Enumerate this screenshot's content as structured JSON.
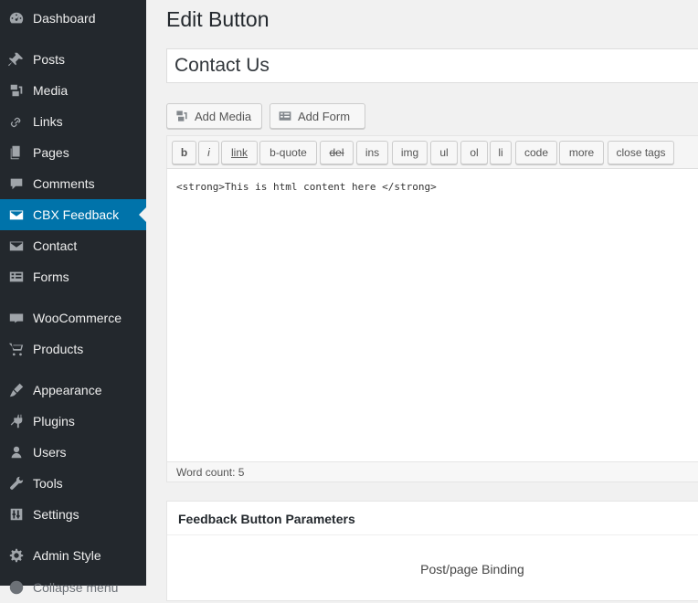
{
  "sidebar": {
    "items": [
      {
        "label": "Dashboard",
        "icon": "dashboard-icon"
      },
      {
        "label": "Posts",
        "icon": "pin-icon"
      },
      {
        "label": "Media",
        "icon": "media-icon"
      },
      {
        "label": "Links",
        "icon": "link-icon"
      },
      {
        "label": "Pages",
        "icon": "pages-icon"
      },
      {
        "label": "Comments",
        "icon": "comment-icon"
      },
      {
        "label": "CBX Feedback",
        "icon": "envelope-icon",
        "active": true
      },
      {
        "label": "Contact",
        "icon": "envelope-icon"
      },
      {
        "label": "Forms",
        "icon": "forms-icon"
      },
      {
        "label": "WooCommerce",
        "icon": "woo-icon"
      },
      {
        "label": "Products",
        "icon": "cart-icon"
      },
      {
        "label": "Appearance",
        "icon": "brush-icon"
      },
      {
        "label": "Plugins",
        "icon": "plug-icon"
      },
      {
        "label": "Users",
        "icon": "user-icon"
      },
      {
        "label": "Tools",
        "icon": "wrench-icon"
      },
      {
        "label": "Settings",
        "icon": "settings-icon"
      },
      {
        "label": "Admin Style",
        "icon": "gear-icon"
      },
      {
        "label": "Collapse menu",
        "icon": "collapse-icon"
      }
    ],
    "colors": {
      "background": "#23282d",
      "active": "#0073aa"
    }
  },
  "page": {
    "title": "Edit Button",
    "post_title": "Contact Us"
  },
  "media_buttons": {
    "add_media": "Add Media",
    "add_form": "Add Form"
  },
  "quicktags": [
    "b",
    "i",
    "link",
    "b-quote",
    "del",
    "ins",
    "img",
    "ul",
    "ol",
    "li",
    "code",
    "more",
    "close tags"
  ],
  "editor": {
    "content": "<strong>This is html content here </strong>",
    "word_count": "Word count: 5"
  },
  "metabox": {
    "title": "Feedback Button Parameters",
    "binding_label": "Post/page Binding"
  }
}
